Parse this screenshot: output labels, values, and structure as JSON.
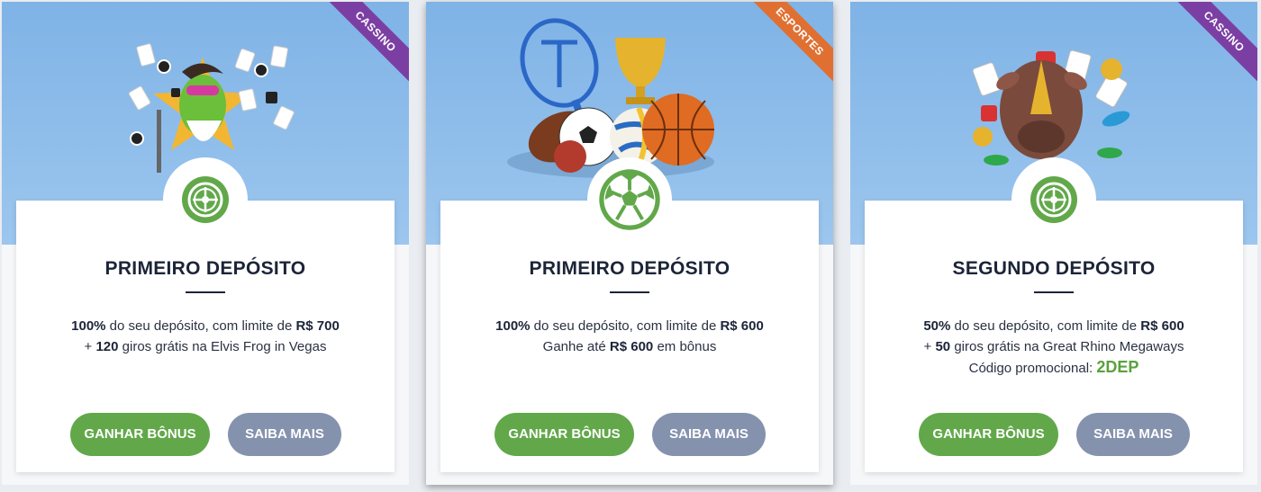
{
  "cards": [
    {
      "ribbon": "CASSINO",
      "ribbon_color": "#7b3fa4",
      "title": "PRIMEIRO DEPÓSITO",
      "line1": {
        "pct": "100%",
        "mid": " do seu depósito, com limite de ",
        "amount": "R$ 700"
      },
      "line2": {
        "pre": "+ ",
        "num": "120",
        "rest": " giros grátis na Elvis Frog in Vegas"
      },
      "primary_button": "GANHAR BÔNUS",
      "secondary_button": "SAIBA MAIS",
      "badge_icon": "roulette-icon"
    },
    {
      "ribbon": "ESPORTES",
      "ribbon_color": "#e07032",
      "title": "PRIMEIRO DEPÓSITO",
      "line1": {
        "pct": "100%",
        "mid": " do seu depósito, com limite de ",
        "amount": "R$ 600"
      },
      "line2": {
        "pre": "Ganhe até ",
        "amount": "R$ 600",
        "rest": " em bônus"
      },
      "primary_button": "GANHAR BÔNUS",
      "secondary_button": "SAIBA MAIS",
      "badge_icon": "soccer-ball-icon"
    },
    {
      "ribbon": "CASSINO",
      "ribbon_color": "#7b3fa4",
      "title": "SEGUNDO DEPÓSITO",
      "line1": {
        "pct": "50%",
        "mid": " do seu depósito, com limite de ",
        "amount": "R$ 600"
      },
      "line2": {
        "pre": "+ ",
        "num": "50",
        "rest": " giros grátis na Great Rhino Megaways"
      },
      "line3": {
        "label": "Código promocional: ",
        "code": "2DEP"
      },
      "primary_button": "GANHAR BÔNUS",
      "secondary_button": "SAIBA MAIS",
      "badge_icon": "roulette-icon"
    }
  ],
  "colors": {
    "accent_green": "#62a84a",
    "secondary_gray": "#8592ad",
    "hero_blue": "#7fb3e6"
  }
}
